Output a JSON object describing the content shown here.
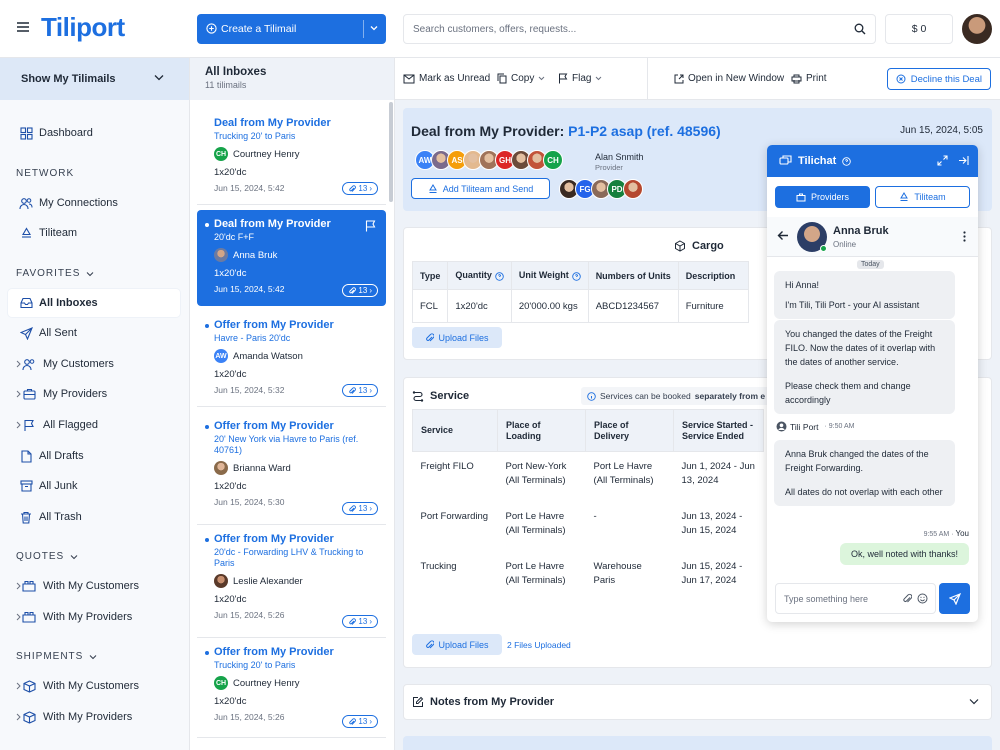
{
  "app": {
    "logo": "Tiliport"
  },
  "topbar": {
    "create_label": "Create a Tilimail",
    "search_placeholder": "Search customers, offers, requests...",
    "balance": "$ 0"
  },
  "nav": {
    "show_tilimails": "Show My Tilimails",
    "dashboard": "Dashboard",
    "network_heading": "NETWORK",
    "my_connections": "My Connections",
    "tiliteam": "Tiliteam",
    "favorites_heading": "FAVORITES",
    "all_inboxes": "All Inboxes",
    "all_sent": "All Sent",
    "my_customers": "My Customers",
    "my_providers": "My Providers",
    "all_flagged": "All Flagged",
    "all_drafts": "All Drafts",
    "all_junk": "All Junk",
    "all_trash": "All Trash",
    "quotes_heading": "QUOTES",
    "quotes_customers": "With My Customers",
    "quotes_providers": "With My Providers",
    "shipments_heading": "SHIPMENTS",
    "shipments_customers": "With My Customers",
    "shipments_providers": "With My Providers"
  },
  "inbox": {
    "title": "All Inboxes",
    "count": "11 tilimails",
    "items": [
      {
        "title": "Deal from My Provider",
        "route": "Trucking 20' to Paris",
        "person": "Courtney Henry",
        "initials": "CH",
        "avatar_color": "#16a34a",
        "qty": "1x20'dc",
        "date": "Jun 15, 2024, 5:42",
        "attachments": "13"
      },
      {
        "title": "Deal from My Provider",
        "route": "20'dc F+F",
        "person": "Anna Bruk",
        "initials": "",
        "avatar_color": "#6b7aa1",
        "qty": "1x20'dc",
        "date": "Jun 15, 2024, 5:42",
        "attachments": "13"
      },
      {
        "title": "Offer from My Provider",
        "route": "Havre - Paris 20'dc",
        "person": "Amanda Watson",
        "initials": "AW",
        "avatar_color": "#3b82f6",
        "qty": "1x20'dc",
        "date": "Jun 15, 2024, 5:32",
        "attachments": "13"
      },
      {
        "title": "Offer from My Provider",
        "route": "20' New York via Havre to Paris (ref. 40761)",
        "person": "Brianna Ward",
        "initials": "",
        "avatar_color": "#b98a6e",
        "qty": "1x20'dc",
        "date": "Jun 15, 2024, 5:30",
        "attachments": "13"
      },
      {
        "title": "Offer from My Provider",
        "route": "20'dc - Forwarding LHV & Trucking to Paris",
        "person": "Leslie Alexander",
        "initials": "",
        "avatar_color": "#8a5a44",
        "qty": "1x20'dc",
        "date": "Jun 15, 2024, 5:26",
        "attachments": "13"
      },
      {
        "title": "Offer from My Provider",
        "route": "Trucking 20' to Paris",
        "person": "Courtney Henry",
        "initials": "CH",
        "avatar_color": "#16a34a",
        "qty": "1x20'dc",
        "date": "Jun 15, 2024, 5:26",
        "attachments": "13"
      }
    ]
  },
  "toolbar": {
    "mark_unread": "Mark as Unread",
    "copy": "Copy",
    "flag": "Flag",
    "open_new_window": "Open in New Window",
    "print": "Print",
    "decline": "Decline this Deal"
  },
  "deal": {
    "title_prefix": "Deal from My Provider:",
    "title_ref": "P1-P2 asap (ref. 48596)",
    "date": "Jun 15, 2024, 5:05",
    "provider_name": "Alan Snmith",
    "provider_role": "Provider",
    "add_tiliteam": "Add Tiliteam and Send",
    "participants_row1": [
      {
        "label": "AW",
        "color": "#3b82f6"
      },
      {
        "label": "",
        "color": "#7a6a8c"
      },
      {
        "label": "AS",
        "color": "#f59e0b"
      },
      {
        "label": "",
        "color": "#e3b98f"
      },
      {
        "label": "",
        "color": "#a0735a"
      },
      {
        "label": "GH",
        "color": "#dc2626"
      },
      {
        "label": "",
        "color": "#6b4a3a"
      },
      {
        "label": "",
        "color": "#c2543a"
      },
      {
        "label": "CH",
        "color": "#16a34a"
      }
    ],
    "participants_row2": [
      {
        "label": "",
        "color": "#3a2a22"
      },
      {
        "label": "FG",
        "color": "#2563eb"
      },
      {
        "label": "",
        "color": "#8a6a5a"
      },
      {
        "label": "PD",
        "color": "#15803d"
      },
      {
        "label": "",
        "color": "#b5482f"
      }
    ]
  },
  "cargo": {
    "title": "Cargo",
    "headers": [
      "Type",
      "Quantity",
      "Unit Weight",
      "Numbers of Units",
      "Description"
    ],
    "row": [
      "FCL",
      "1x20'dc",
      "20'000.00 kgs",
      "ABCD1234567",
      "Furniture"
    ],
    "upload": "Upload Files"
  },
  "service": {
    "title": "Service",
    "note_prefix": "Services can be booked",
    "note_bold": "separately from e",
    "headers": [
      "Service",
      "Place of Loading",
      "Place of Delivery",
      "Service Started - Service Ended"
    ],
    "rows": [
      [
        "Freight FILO",
        "Port New-York (All Terminals)",
        "Port Le Havre (All Terminals)",
        "Jun 1, 2024 - Jun 13, 2024"
      ],
      [
        "Port Forwarding",
        "Port Le Havre (All Terminals)",
        "-",
        "Jun 13, 2024 - Jun 15, 2024"
      ],
      [
        "Trucking",
        "Port Le Havre (All Terminals)",
        "Warehouse Paris",
        "Jun 15, 2024 - Jun 17, 2024"
      ]
    ],
    "upload": "Upload Files",
    "files_uploaded": "2 Files Uploaded"
  },
  "notes": {
    "title": "Notes from My Provider"
  },
  "tilichat": {
    "title": "Tilichat",
    "tab_providers": "Providers",
    "tab_tiliteam": "Tiliteam",
    "contact_name": "Anna Bruk",
    "contact_status": "Online",
    "today": "Today",
    "msg1_a": "Hi Anna!",
    "msg1_b": "I'm Tili, Tili Port - your AI assistant",
    "msg2_a": "You changed the dates of the Freight FILO. Now the dates of it overlap with the dates of another service.",
    "msg2_b": "Please check them and change accordingly",
    "sender_name": "Tili Port",
    "sender_time": "· 9:50 AM",
    "msg3_a": "Anna Bruk changed the dates of the Freight Forwarding.",
    "msg3_b": "All dates do not overlap with each other",
    "you_time": "9:55 AM ·",
    "you_label": "You",
    "my_msg": "Ok, well noted with thanks!",
    "input_placeholder": "Type something here"
  }
}
